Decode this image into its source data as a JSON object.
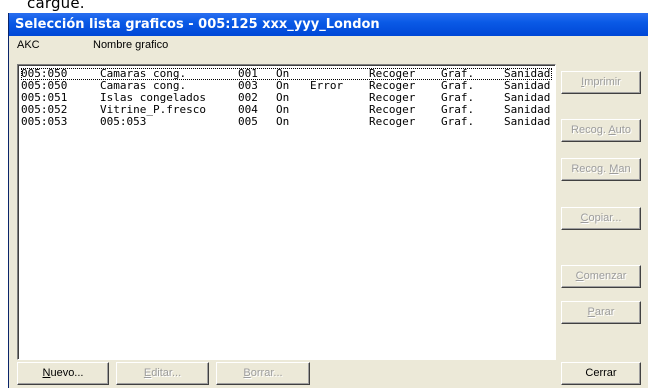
{
  "background_text": "cargue.",
  "window": {
    "title": "Selección lista graficos - 005:125  xxx_yyy_London"
  },
  "columns": [
    {
      "label": "AKC"
    },
    {
      "label": "Nombre grafico"
    }
  ],
  "rows": [
    {
      "akc": "005:050",
      "name": "Camaras cong.",
      "num": "001",
      "state": "On",
      "status": "",
      "action": "Recoger",
      "type": "Graf.",
      "area": "Sanidad",
      "selected": true
    },
    {
      "akc": "005:050",
      "name": "Camaras cong.",
      "num": "003",
      "state": "On",
      "status": "Error",
      "action": "Recoger",
      "type": "Graf.",
      "area": "Sanidad"
    },
    {
      "akc": "005:051",
      "name": "Islas congelados",
      "num": "002",
      "state": "On",
      "status": "",
      "action": "Recoger",
      "type": "Graf.",
      "area": "Sanidad"
    },
    {
      "akc": "005:052",
      "name": "Vitrine_P.fresco",
      "num": "004",
      "state": "On",
      "status": "",
      "action": "Recoger",
      "type": "Graf.",
      "area": "Sanidad"
    },
    {
      "akc": "005:053",
      "name": "005:053",
      "num": "005",
      "state": "On",
      "status": "",
      "action": "Recoger",
      "type": "Graf.",
      "area": "Sanidad"
    }
  ],
  "side_buttons": {
    "imprimir": {
      "pre": "",
      "ul": "I",
      "post": "mprimir"
    },
    "recog_auto": {
      "pre": "Recog. ",
      "ul": "A",
      "post": "uto"
    },
    "recog_man": {
      "pre": "Recog. ",
      "ul": "M",
      "post": "an"
    },
    "copiar": {
      "pre": "",
      "ul": "C",
      "post": "opiar..."
    },
    "comenzar": {
      "pre": "",
      "ul": "C",
      "post": "omenzar"
    },
    "parar": {
      "pre": "",
      "ul": "P",
      "post": "arar"
    }
  },
  "bottom_buttons": {
    "nuevo": {
      "pre": "",
      "ul": "N",
      "post": "uevo..."
    },
    "editar": {
      "pre": "",
      "ul": "E",
      "post": "ditar..."
    },
    "borrar": {
      "pre": "",
      "ul": "B",
      "post": "orrar..."
    },
    "cerrar": "Cerrar"
  }
}
